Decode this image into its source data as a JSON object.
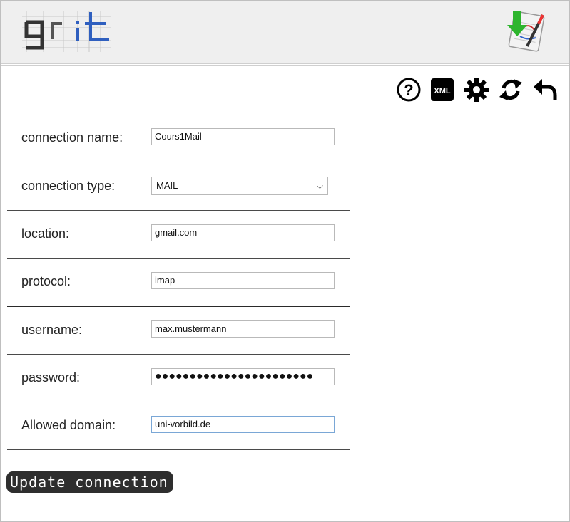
{
  "header": {
    "logo_text": "grit",
    "app_icon": "download-notes-icon"
  },
  "toolbar": [
    {
      "name": "help-icon",
      "label": "?"
    },
    {
      "name": "xml-icon",
      "label": "XML"
    },
    {
      "name": "settings-gear-icon",
      "label": ""
    },
    {
      "name": "refresh-icon",
      "label": ""
    },
    {
      "name": "back-arrow-icon",
      "label": ""
    }
  ],
  "form": {
    "connection_name": {
      "label": "connection name:",
      "value": "Cours1Mail"
    },
    "connection_type": {
      "label": "connection type:",
      "value": "MAIL"
    },
    "location": {
      "label": "location:",
      "value": "gmail.com"
    },
    "protocol": {
      "label": "protocol:",
      "value": "imap"
    },
    "username": {
      "label": "username:",
      "value": "max.mustermann"
    },
    "password": {
      "label": "password:",
      "value": "●●●●●●●●●●●●●●●●●●●●●●●"
    },
    "allowed_domain": {
      "label": "Allowed domain:",
      "value": "uni-vorbild.de"
    }
  },
  "update_button": "Update connection"
}
